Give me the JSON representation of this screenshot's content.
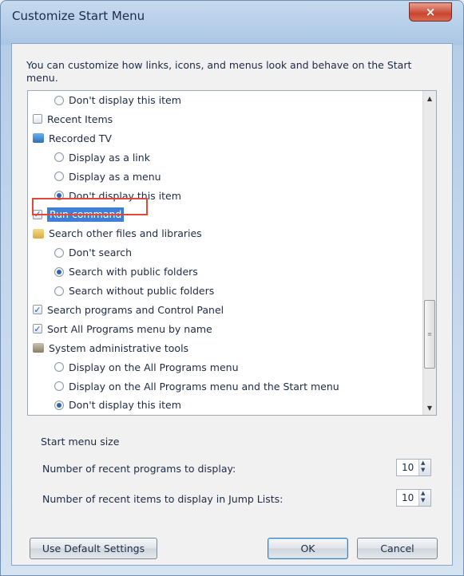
{
  "window": {
    "title": "Customize Start Menu",
    "close_glyph": "×"
  },
  "description": "You can customize how links, icons, and menus look and behave on the Start menu.",
  "list": {
    "items": [
      {
        "kind": "radio",
        "label": "Don't display this item",
        "checked": false
      },
      {
        "kind": "check",
        "label": "Recent Items",
        "checked": false
      },
      {
        "kind": "group",
        "label": "Recorded TV",
        "icon": "recorded-tv-icon"
      },
      {
        "kind": "radio",
        "label": "Display as a link",
        "checked": false
      },
      {
        "kind": "radio",
        "label": "Display as a menu",
        "checked": false
      },
      {
        "kind": "radio",
        "label": "Don't display this item",
        "checked": true
      },
      {
        "kind": "check",
        "label": "Run command",
        "checked": true,
        "selected": true
      },
      {
        "kind": "group",
        "label": "Search other files and libraries",
        "icon": "folder-icon"
      },
      {
        "kind": "radio",
        "label": "Don't search",
        "checked": false
      },
      {
        "kind": "radio",
        "label": "Search with public folders",
        "checked": true
      },
      {
        "kind": "radio",
        "label": "Search without public folders",
        "checked": false
      },
      {
        "kind": "check",
        "label": "Search programs and Control Panel",
        "checked": true
      },
      {
        "kind": "check",
        "label": "Sort All Programs menu by name",
        "checked": true
      },
      {
        "kind": "group",
        "label": "System administrative tools",
        "icon": "admin-tools-icon"
      },
      {
        "kind": "radio",
        "label": "Display on the All Programs menu",
        "checked": false
      },
      {
        "kind": "radio",
        "label": "Display on the All Programs menu and the Start menu",
        "checked": false
      },
      {
        "kind": "radio",
        "label": "Don't display this item",
        "checked": true
      }
    ]
  },
  "start_menu_size": {
    "title": "Start menu size",
    "recent_programs_label": "Number of recent programs to display:",
    "recent_programs_value": "10",
    "recent_items_label": "Number of recent items to display in Jump Lists:",
    "recent_items_value": "10"
  },
  "buttons": {
    "default_settings": "Use Default Settings",
    "ok": "OK",
    "cancel": "Cancel"
  },
  "icons": {
    "check_glyph": "✓",
    "up_arrow": "▲",
    "down_arrow": "▼",
    "grip": "≡"
  },
  "colors": {
    "selection": "#3f7fd8",
    "highlight_outline": "#e0493a",
    "radio_dot": "#2e63b3"
  }
}
